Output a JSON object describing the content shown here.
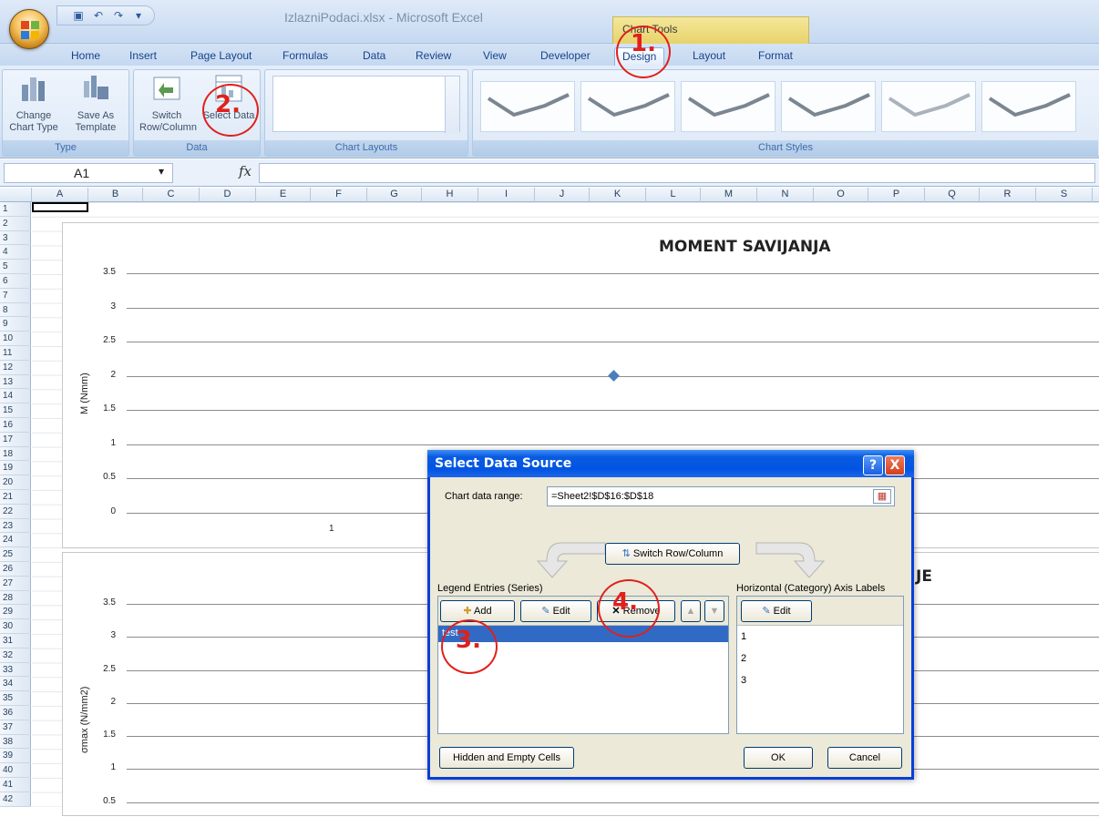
{
  "window": {
    "title": "IzlazniPodaci.xlsx - Microsoft Excel",
    "contextual_group": "Chart Tools"
  },
  "tabs": [
    "Home",
    "Insert",
    "Page Layout",
    "Formulas",
    "Data",
    "Review",
    "View",
    "Developer",
    "Design",
    "Layout",
    "Format"
  ],
  "active_tab": "Design",
  "ribbon": {
    "type_group": {
      "label": "Type",
      "change_chart_type": "Change Chart Type",
      "save_as_template": "Save As Template"
    },
    "data_group": {
      "label": "Data",
      "switch_row_column": "Switch Row/Column",
      "select_data": "Select Data"
    },
    "chart_layouts_label": "Chart Layouts",
    "chart_styles_label": "Chart Styles"
  },
  "formula_bar": {
    "name_box": "A1",
    "fx": "fx",
    "formula": ""
  },
  "columns": [
    "A",
    "B",
    "C",
    "D",
    "E",
    "F",
    "G",
    "H",
    "I",
    "J",
    "K",
    "L",
    "M",
    "N",
    "O",
    "P",
    "Q",
    "R",
    "S"
  ],
  "rows": [
    "1",
    "2",
    "3",
    "4",
    "5",
    "6",
    "7",
    "8",
    "9",
    "10",
    "11",
    "12",
    "13",
    "14",
    "15",
    "16",
    "17",
    "18",
    "19",
    "20",
    "21",
    "22",
    "23",
    "24",
    "25",
    "26",
    "27",
    "28",
    "29",
    "30",
    "31",
    "32",
    "33",
    "34",
    "35",
    "36",
    "37",
    "38",
    "39",
    "40",
    "41",
    "42"
  ],
  "chart_data": [
    {
      "type": "line",
      "title": "MOMENT SAVIJANJA",
      "ylabel": "M (Nmm)",
      "xlabel": "",
      "ylim": [
        0,
        3.5
      ],
      "yticks": [
        "3.5",
        "3",
        "2.5",
        "2",
        "1.5",
        "1",
        "0.5",
        "0"
      ],
      "categories": [
        "1"
      ],
      "series": [
        {
          "values": [
            2
          ]
        }
      ]
    },
    {
      "type": "line",
      "title": "JE",
      "ylabel": "σmax (N/mm2)",
      "xlabel": "",
      "ylim": [
        0,
        3.5
      ],
      "yticks": [
        "3.5",
        "3",
        "2.5",
        "2",
        "1.5",
        "1",
        "0.5"
      ],
      "categories": [],
      "series": []
    }
  ],
  "dialog": {
    "title": "Select Data Source",
    "help": "?",
    "close": "X",
    "chart_data_range_label": "Chart data range:",
    "chart_data_range_value": "=Sheet2!$D$16:$D$18",
    "switch_row_column": "Switch Row/Column",
    "legend_entries_label": "Legend Entries (Series)",
    "add": "Add",
    "edit": "Edit",
    "remove": "Remove",
    "series_items": [
      "test"
    ],
    "axis_labels_label": "Horizontal (Category) Axis Labels",
    "axis_edit": "Edit",
    "axis_items": [
      "1",
      "2",
      "3"
    ],
    "hidden_empty_cells": "Hidden and Empty Cells",
    "ok": "OK",
    "cancel": "Cancel"
  },
  "annotations": [
    "1.",
    "2.",
    "3.",
    "4."
  ]
}
